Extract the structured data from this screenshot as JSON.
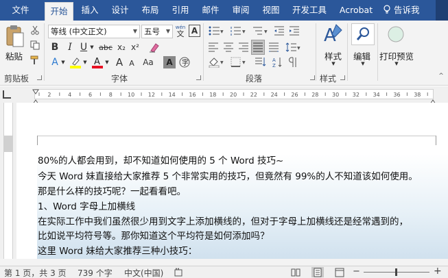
{
  "tabs": [
    "文件",
    "开始",
    "插入",
    "设计",
    "布局",
    "引用",
    "邮件",
    "审阅",
    "视图",
    "开发工具",
    "Acrobat"
  ],
  "tell_me": "告诉我",
  "ribbon": {
    "clipboard": {
      "paste": "粘贴",
      "label": "剪贴板"
    },
    "font": {
      "name": "等线 (中文正文)",
      "size": "五号",
      "label": "字体",
      "bold": "B",
      "italic": "I",
      "underline": "U",
      "strike": "abc",
      "sub": "x₂",
      "sup": "x²",
      "grow": "A",
      "shrink": "A",
      "case": "Aa",
      "wen": "wén",
      "wen_char": "文",
      "border_a": "A",
      "effects_a": "A",
      "shade_a": "A"
    },
    "paragraph": {
      "label": "段落"
    },
    "styles": {
      "button": "样式",
      "label": "样式"
    },
    "editing": {
      "button": "编辑"
    },
    "print": {
      "button": "打印预览"
    },
    "colors": {
      "accent": "#2b579a",
      "highlight": "#ffff00",
      "font_color": "#e81123"
    }
  },
  "ruler": {
    "marks": [
      "2",
      "4",
      "6",
      "8",
      "10",
      "12",
      "14",
      "16",
      "18",
      "20",
      "22",
      "24",
      "26",
      "28",
      "30",
      "32",
      "34",
      "36",
      "38"
    ]
  },
  "document": {
    "lines": [
      "80%的人都会用到，却不知道如何使用的 5 个 Word 技巧~",
      "今天 Word 妹直接给大家推荐 5 个非常实用的技巧，但竟然有 99%的人不知道该如何使用。",
      "那是什么样的技巧呢？一起看看吧。",
      "1、Word 字母上加横线",
      "在实际工作中我们虽然很少用到文字上添加横线的，但对于字母上加横线还是经常遇到的，",
      "比如说平均符号等。那你知道这个平均符是如何添加吗？",
      "这里 Word 妹给大家推荐三种小技巧："
    ]
  },
  "status": {
    "page": "第 1 页，共 3 页",
    "words": "739 个字",
    "language": "中文(中国)"
  }
}
